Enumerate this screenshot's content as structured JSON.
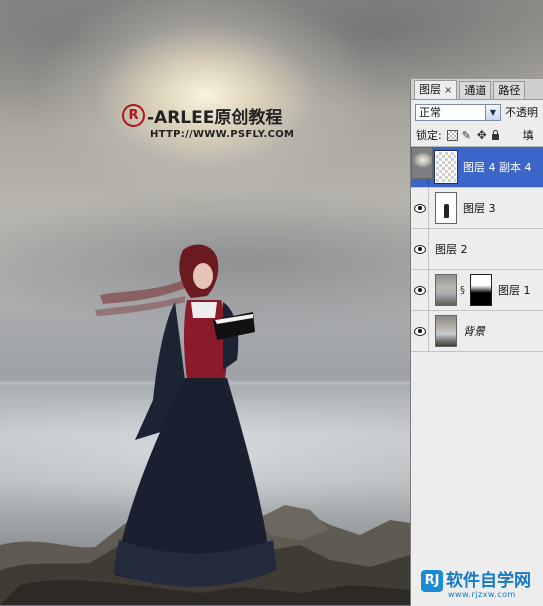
{
  "watermark": {
    "mark": "R",
    "title": "-ARLEE原创教程",
    "url": "HTTP://WWW.PSFLY.COM"
  },
  "layers_panel": {
    "tabs": [
      {
        "label": "图层",
        "close": "×",
        "active": true
      },
      {
        "label": "通道",
        "active": false
      },
      {
        "label": "路径",
        "active": false
      }
    ],
    "blend_mode": "正常",
    "opacity_label": "不透明",
    "lock_label": "锁定:",
    "fill_label": "填",
    "layers": [
      {
        "name": "图层 4 副本 4",
        "selected": true,
        "thumb": "checker"
      },
      {
        "name": "图层 3",
        "selected": false,
        "thumb": "girl"
      },
      {
        "name": "图层 2",
        "selected": false,
        "thumb": "sky"
      },
      {
        "name": "图层 1",
        "selected": false,
        "thumb": "sea",
        "has_mask": true
      },
      {
        "name": "背景",
        "selected": false,
        "thumb": "bg",
        "italic": true
      }
    ]
  },
  "site_logo": {
    "mark": "RJ",
    "text": "软件自学网",
    "url": "www.rjzxw.com"
  },
  "colors": {
    "selected_layer": "#3b66c8",
    "watermark_mark": "#b3141b",
    "logo_blue": "#1778c4"
  }
}
